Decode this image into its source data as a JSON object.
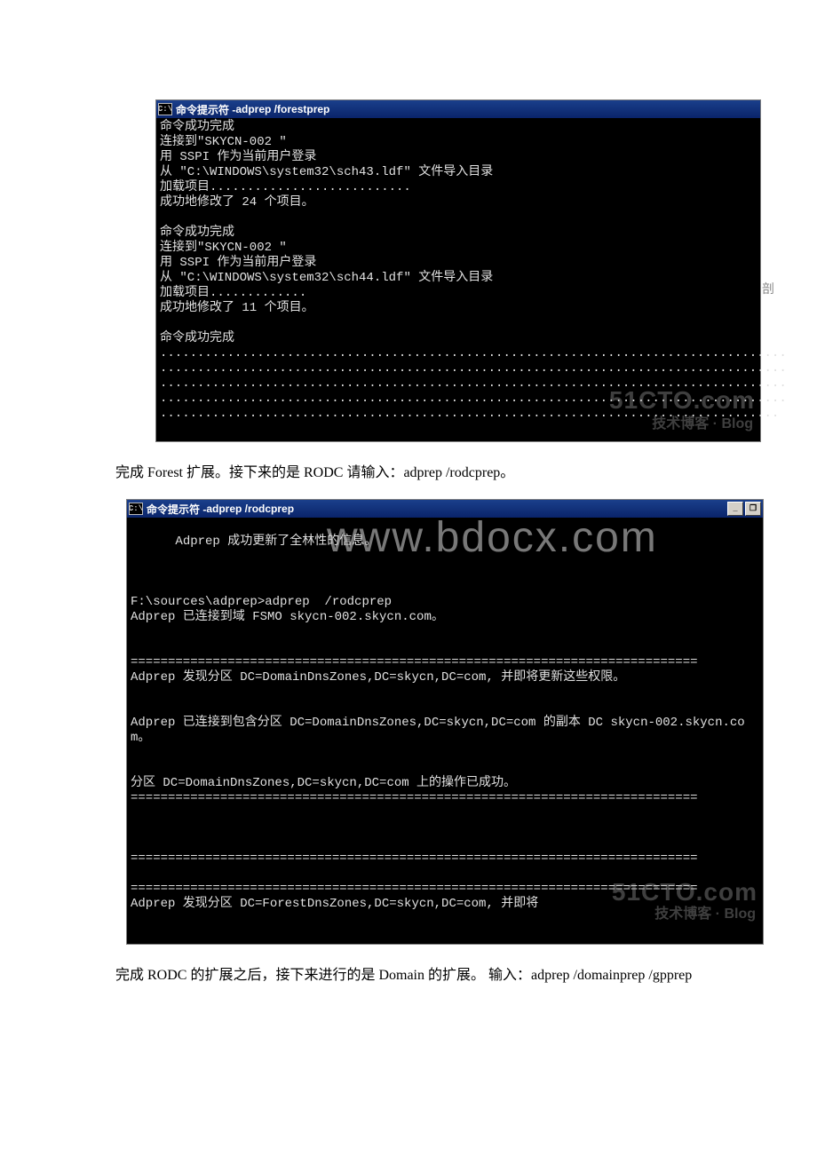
{
  "console1": {
    "title_prefix": "命令提示符 - ",
    "title_cmd": "adprep /forestprep",
    "icon_text": "C:\\",
    "side_char": "剖",
    "lines": "命令成功完成\n连接到\"SKYCN-002 \"\n用 SSPI 作为当前用户登录\n从 \"C:\\WINDOWS\\system32\\sch43.ldf\" 文件导入目录\n加载项目...........................\n成功地修改了 24 个项目。\n\n命令成功完成\n连接到\"SKYCN-002 \"\n用 SSPI 作为当前用户登录\n从 \"C:\\WINDOWS\\system32\\sch44.ldf\" 文件导入目录\n加载项目.............\n成功地修改了 11 个项目。\n\n命令成功完成\n....................................................................................\n....................................................................................\n....................................................................................\n....................................................................................\n...................................................................................",
    "watermark_main": "51CTO.com",
    "watermark_sub": "技术博客 · Blog"
  },
  "para1": "完成 Forest 扩展。接下来的是 RODC 请输入：adprep /rodcprep。",
  "console2": {
    "title_prefix": "命令提示符 - ",
    "title_cmd": "adprep  /rodcprep",
    "icon_text": "C:\\",
    "big_watermark": "www.bdocx.com",
    "lines": "Adprep 成功更新了全林性的信息。\n\n\n\nF:\\sources\\adprep>adprep  /rodcprep\nAdprep 已连接到域 FSMO skycn-002.skycn.com。\n\n\n============================================================================\nAdprep 发现分区 DC=DomainDnsZones,DC=skycn,DC=com, 并即将更新这些权限。\n\n\nAdprep 已连接到包含分区 DC=DomainDnsZones,DC=skycn,DC=com 的副本 DC skycn-002.skycn.com。\n\n\n分区 DC=DomainDnsZones,DC=skycn,DC=com 上的操作已成功。\n============================================================================\n\n\n\n============================================================================\n\n============================================================================\nAdprep 发现分区 DC=ForestDnsZones,DC=skycn,DC=com, 并即将",
    "watermark_main": "51CTO.com",
    "watermark_sub": "技术博客 · Blog",
    "minimize": "_",
    "restore": "❐"
  },
  "para2": "完成 RODC 的扩展之后，接下来进行的是 Domain 的扩展。 输入：adprep /domainprep /gpprep"
}
